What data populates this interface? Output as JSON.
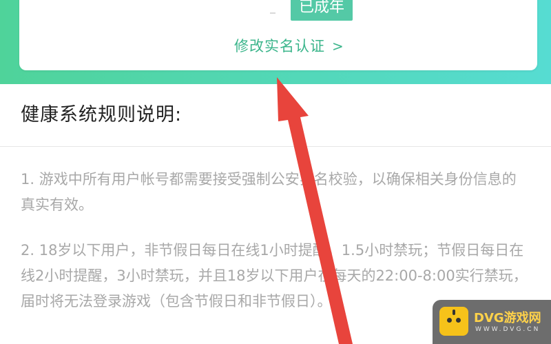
{
  "header": {
    "gradient_colors": [
      "#4fd39a",
      "#56dcd2"
    ]
  },
  "status_card": {
    "badge_label": "已成年",
    "modify_link_label": "修改实名认证",
    "modify_chevron": ">"
  },
  "section": {
    "title": "健康系统规则说明:"
  },
  "rules": [
    "1. 游戏中所有用户帐号都需要接受强制公安实名校验，以确保相关身份信息的真实有效。",
    "2. 18岁以下用户，非节假日每日在线1小时提醒，1.5小时禁玩；节假日每日在线2小时提醒，3小时禁玩，并且18岁以下用户在每天的22:00-8:00实行禁玩，届时将无法登录游戏（包含节假日和非节假日）。"
  ],
  "annotation": {
    "arrow_color": "#e8443c"
  },
  "watermark": {
    "title": "DVG游戏网",
    "subtitle": "WWW.DVG.CN",
    "logo_color": "#f6c21a"
  }
}
